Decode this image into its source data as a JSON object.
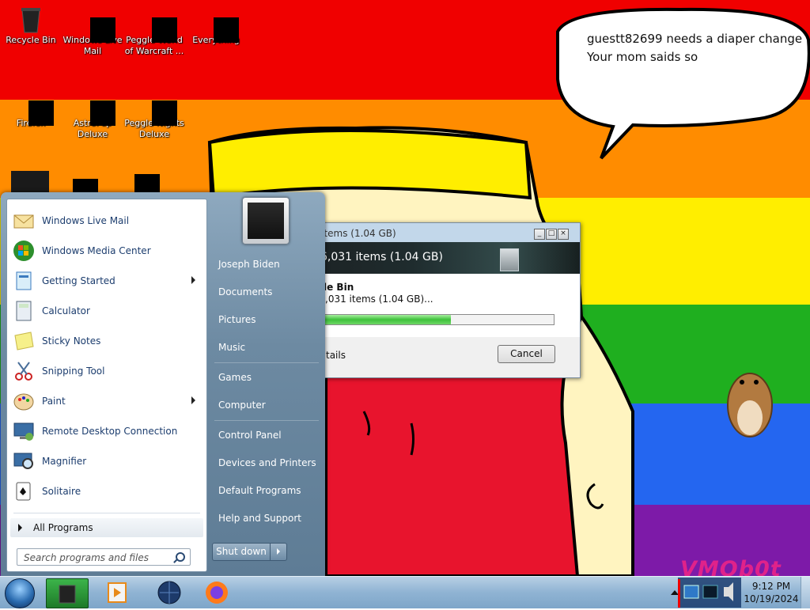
{
  "desktop": {
    "wallpaper_colors": [
      "#f00000",
      "#ff8c00",
      "#ffee00",
      "#1faf1f",
      "#2466f0",
      "#7d1aa8"
    ],
    "speech_bubble": {
      "line1": "guestt82699 needs a diaper change",
      "line2": "Your mom saids so"
    },
    "icons": [
      {
        "label": "Recycle Bin"
      },
      {
        "label": "Windows Live Mail"
      },
      {
        "label": "Peggle World of Warcraft ..."
      },
      {
        "label": "Everything"
      },
      {
        "label": "Firefox"
      },
      {
        "label": "AstroPop Deluxe"
      },
      {
        "label": "Peggle Nights Deluxe"
      }
    ],
    "watermark": "VMOb0t"
  },
  "start_menu": {
    "programs": [
      {
        "label": "Windows Live Mail",
        "icon": "mail-icon"
      },
      {
        "label": "Windows Media Center",
        "icon": "media-center-icon"
      },
      {
        "label": "Getting Started",
        "icon": "getting-started-icon"
      },
      {
        "label": "Calculator",
        "icon": "calculator-icon"
      },
      {
        "label": "Sticky Notes",
        "icon": "sticky-notes-icon"
      },
      {
        "label": "Snipping Tool",
        "icon": "snipping-tool-icon"
      },
      {
        "label": "Paint",
        "icon": "paint-icon"
      },
      {
        "label": "Remote Desktop Connection",
        "icon": "remote-desktop-icon"
      },
      {
        "label": "Magnifier",
        "icon": "magnifier-icon"
      },
      {
        "label": "Solitaire",
        "icon": "solitaire-icon"
      }
    ],
    "all_programs": "All Programs",
    "search_placeholder": "Search programs and files",
    "right_items": [
      "Joseph Biden",
      "Documents",
      "Pictures",
      "Music",
      "Games",
      "Computer",
      "Control Panel",
      "Devices and Printers",
      "Default Programs",
      "Help and Support"
    ],
    "shutdown_label": "Shut down"
  },
  "dialog": {
    "title": "31 items (1.04 GB)",
    "header": "6,031 items (1.04 GB)",
    "name": "le Bin",
    "count": ",031 items (1.04 GB)...",
    "progress": 0.55,
    "details": "tails",
    "cancel": "Cancel"
  },
  "taskbar": {
    "time": "9:12 PM",
    "date": "10/19/2024"
  }
}
